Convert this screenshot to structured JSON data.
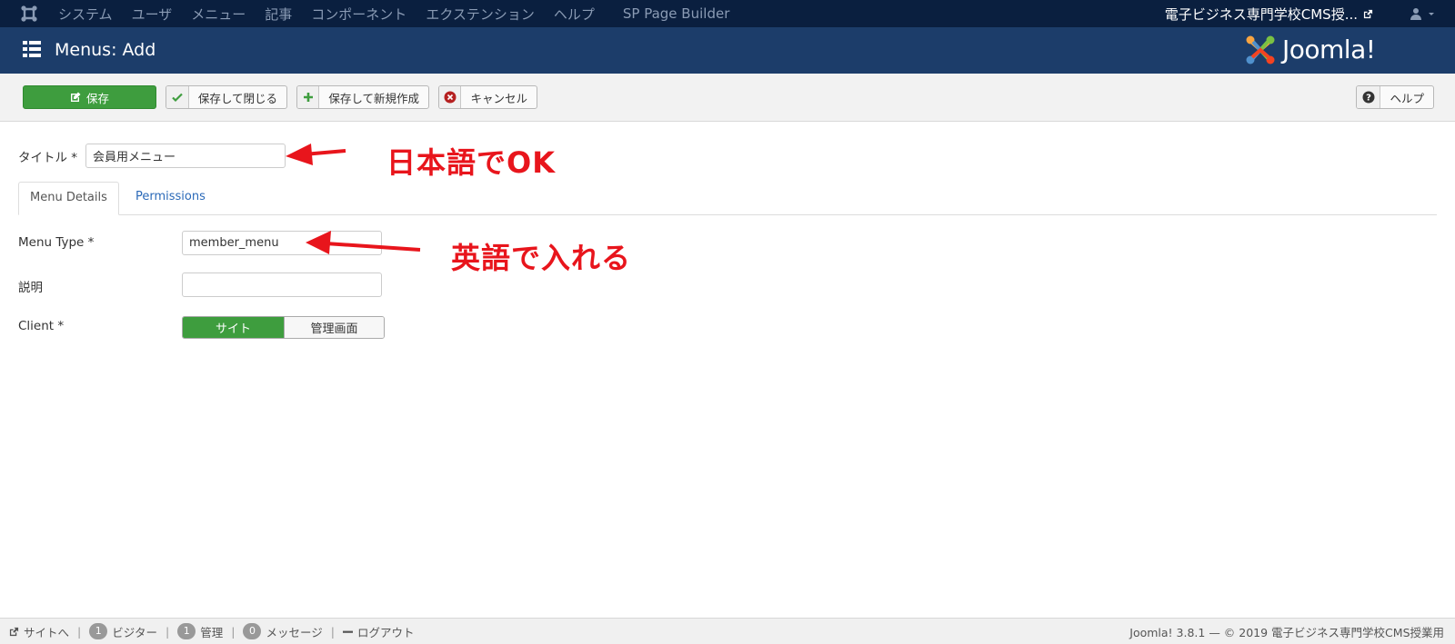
{
  "topnav": {
    "menu": [
      "システム",
      "ユーザ",
      "メニュー",
      "記事",
      "コンポーネント",
      "エクステンション",
      "ヘルプ",
      "SP Page Builder"
    ],
    "site_name": "電子ビジネス専門学校CMS授..."
  },
  "header": {
    "title": "Menus: Add",
    "brand": "Joomla!"
  },
  "toolbar": {
    "save": "保存",
    "save_close": "保存して閉じる",
    "save_new": "保存して新規作成",
    "cancel": "キャンセル",
    "help": "ヘルプ"
  },
  "form": {
    "title_label": "タイトル *",
    "title_value": "会員用メニュー",
    "tabs": [
      "Menu Details",
      "Permissions"
    ],
    "menu_type_label": "Menu Type *",
    "menu_type_value": "member_menu",
    "description_label": "説明",
    "description_value": "",
    "client_label": "Client *",
    "client_options": [
      "サイト",
      "管理画面"
    ],
    "client_selected": "サイト"
  },
  "annotations": {
    "title_note": "日本語でOK",
    "menu_type_note": "英語で入れる",
    "color": "#e8151c"
  },
  "footer": {
    "view_site": "サイトへ",
    "visitors_count": "1",
    "visitors_label": "ビジター",
    "admins_count": "1",
    "admins_label": "管理",
    "messages_count": "0",
    "messages_label": "メッセージ",
    "logout": "ログアウト",
    "copyright": "Joomla! 3.8.1 — © 2019 電子ビジネス専門学校CMS授業用"
  },
  "colors": {
    "topnav_bg": "#0a1f3f",
    "header_bg": "#1c3d6a",
    "primary_green": "#3e9d3e",
    "link_blue": "#2a69b8"
  }
}
